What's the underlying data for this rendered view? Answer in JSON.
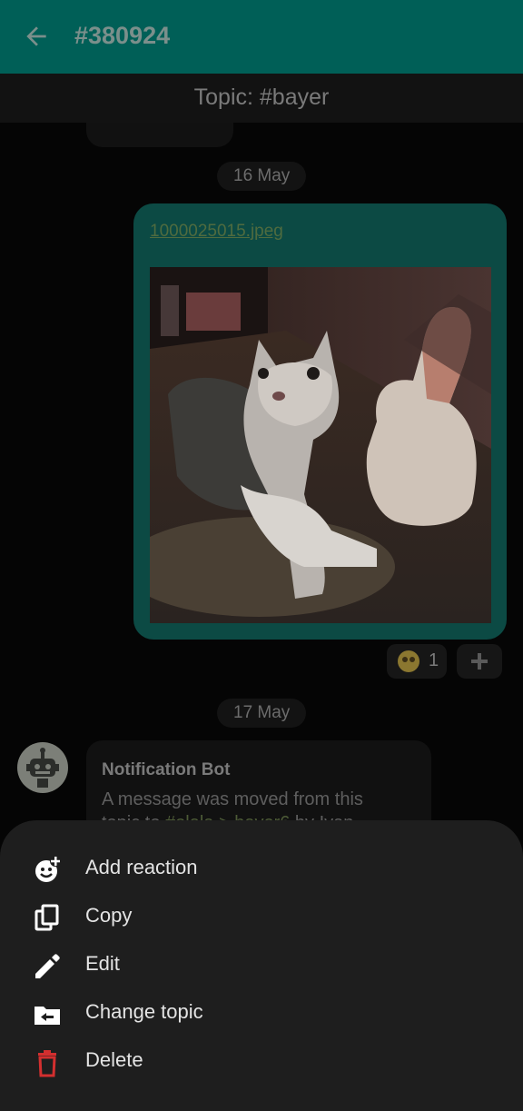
{
  "header": {
    "title": "#380924"
  },
  "topic_bar": {
    "label": "Topic: #bayer"
  },
  "messages": {
    "date_1": "16 May",
    "attachment": {
      "file_name": "1000025015.jpeg"
    },
    "reactions": {
      "emoji_count": "1"
    },
    "date_2": "17 May",
    "bot": {
      "sender": "Notification Bot",
      "text_line_1": "A message was moved from this",
      "text_prefix": "topic to ",
      "text_link": "#olala > bayer6",
      "text_suffix": " by Ivan"
    }
  },
  "action_sheet": {
    "items": [
      {
        "label": "Add reaction",
        "icon": "add-reaction-icon"
      },
      {
        "label": "Copy",
        "icon": "copy-icon"
      },
      {
        "label": "Edit",
        "icon": "edit-pencil-icon"
      },
      {
        "label": "Change topic",
        "icon": "folder-move-icon"
      },
      {
        "label": "Delete",
        "icon": "trash-icon"
      }
    ]
  },
  "colors": {
    "app_bar": "#005f57",
    "sent_bubble": "#0c4a44",
    "sheet_bg": "#1e1e1e",
    "delete_red": "#d32f2f"
  }
}
